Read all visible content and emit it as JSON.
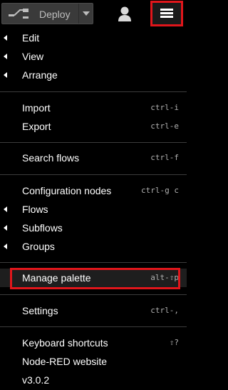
{
  "header": {
    "deploy_label": "Deploy"
  },
  "menu": {
    "items": [
      {
        "label": "Edit",
        "submenu": true
      },
      {
        "label": "View",
        "submenu": true
      },
      {
        "label": "Arrange",
        "submenu": true
      },
      {
        "label": "Import",
        "shortcut": "ctrl-i"
      },
      {
        "label": "Export",
        "shortcut": "ctrl-e"
      },
      {
        "label": "Search flows",
        "shortcut": "ctrl-f"
      },
      {
        "label": "Configuration nodes",
        "shortcut": "ctrl-g c"
      },
      {
        "label": "Flows",
        "submenu": true
      },
      {
        "label": "Subflows",
        "submenu": true
      },
      {
        "label": "Groups",
        "submenu": true
      },
      {
        "label": "Manage palette",
        "shortcut": "alt-⇧p"
      },
      {
        "label": "Settings",
        "shortcut": "ctrl-,"
      },
      {
        "label": "Keyboard shortcuts",
        "shortcut": "⇧?"
      },
      {
        "label": "Node-RED website"
      },
      {
        "label": "v3.0.2"
      }
    ]
  },
  "colors": {
    "highlight_border": "#e0161b",
    "background": "#000000",
    "deploy_button": "#3a3a3a"
  },
  "icons": [
    "deploy-icon",
    "chevron-down-icon",
    "user-icon",
    "hamburger-menu-icon",
    "chevron-left-icon"
  ]
}
